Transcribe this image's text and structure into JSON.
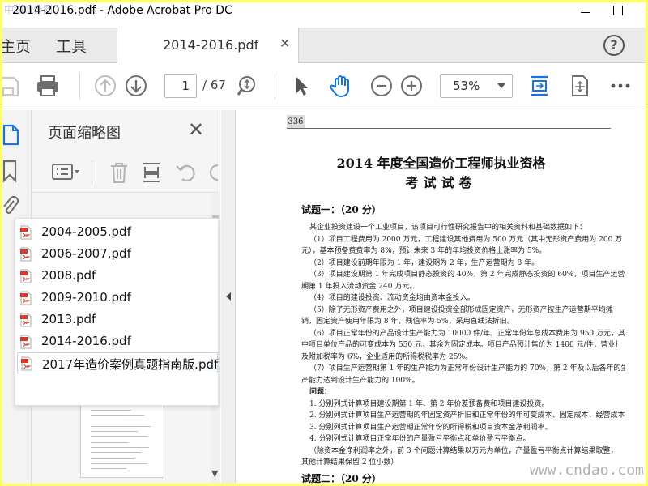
{
  "window": {
    "title": "2014-2016.pdf - Adobe Acrobat Pro DC",
    "watermark_text": "中国造价网"
  },
  "tabs": {
    "home": "主页",
    "tools": "工具",
    "document": "2014-2016.pdf",
    "help": "?"
  },
  "toolbar": {
    "current_page": "1",
    "total_pages": "/ 67",
    "zoom": "53%"
  },
  "panel": {
    "title": "页面缩略图",
    "close": "✕"
  },
  "files": [
    {
      "name": "2004-2005.pdf"
    },
    {
      "name": "2006-2007.pdf"
    },
    {
      "name": "2008.pdf"
    },
    {
      "name": "2009-2010.pdf"
    },
    {
      "name": "2013.pdf"
    },
    {
      "name": "2014-2016.pdf"
    },
    {
      "name": "2017年造价案例真题指南版.pdf"
    }
  ],
  "document": {
    "page_label": "336",
    "title_line1": "2014 年度全国造价工程师执业资格",
    "title_line2": "考试试卷",
    "question1": "试题一：（20 分）",
    "lines": [
      "某企业投资建设一个工业项目，该项目可行性研究报告中的相关资料和基础数据如下：",
      "（1）项目工程费用为 2000 万元，工程建设其他费用为 500 万元（其中无形资产费用为 200 万",
      "元），基本预备费费率为 8%，预计未来 3 年的年均投资价格上涨率为 5%。",
      "（2）项目建设前期年限为 1 年，建设期为 2 年，生产运营期为 8 年。",
      "（3）项目建设期第 1 年完成项目静态投资的 40%，第 2 年完成静态投资的 60%，项目生产运营",
      "期第 1 年投入流动资金 240 万元。",
      "（4）项目的建设投资、流动资金均由资本金投入。",
      "（5）除了无形资产费用之外，项目建设投资全部形成固定资产，无形资产按生产运营期平均摊",
      "销，固定资产使用年限为 8 年，残值率为 5%，采用直线法折旧。",
      "（6）项目正常年份的产品设计生产能力为 10000 件/年，正常年份年总成本费用为 950 万元，其",
      "中项目单位产品的可变成本为 550 元，其余为固定成本。项目产品预计售价为 1400 元/件，营业税金",
      "及附加税率为 6%，企业适用的所得税税率为 25%。",
      "（7）项目生产运营期第 1 年的生产能力为正常年份设计生产能力的 70%，第 2 年及以后各年的生",
      "产能力达到设计生产能力的 100%。",
      "问题：",
      "1. 分别列式计算项目建设期第 1 年、第 2 年价差预备费和项目建设投资。",
      "2. 分别列式计算项目生产运营期的年固定资产折旧和正常年份的年可变成本、固定成本、经营成本。",
      "3. 分别列式计算项目生产运营期正常年份的所得税和项目资本金净利润率。",
      "4. 分别列式计算项目正常年份的产量盈亏平衡点和单价盈亏平衡点。",
      "（除资本金净利润率之外，前 3 个问题计算结果以万元为单位，产量盈亏平衡点计算结果取整，",
      "其他计算结果保留 2 位小数）"
    ],
    "question2": "试题二：（20 分）",
    "site_watermark": "www.cndao.com"
  },
  "colors": {
    "accent_blue": "#1473e6",
    "icon_gray": "#6e6e6e",
    "pdf_red": "#d9372b",
    "border_yellow": "#ffff66"
  }
}
